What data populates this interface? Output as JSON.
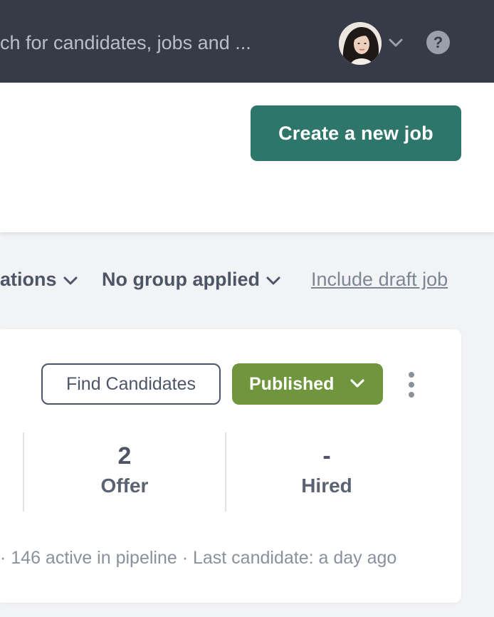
{
  "topbar": {
    "search_placeholder": "ch for candidates, jobs and ...",
    "icons": {
      "avatar": "user-avatar",
      "menu": "chevron-down-icon",
      "help": "help-icon"
    },
    "help_glyph": "?"
  },
  "header": {
    "create_job_label": "Create a new job"
  },
  "filters": {
    "locations_label": "ations",
    "group_label": "No group applied",
    "include_draft_label": "Include draft job"
  },
  "job_card": {
    "find_candidates_label": "Find Candidates",
    "status_label": "Published",
    "stats": [
      {
        "value": "2",
        "label": "Offer"
      },
      {
        "value": "-",
        "label": "Hired"
      }
    ],
    "meta": "· 146 active in pipeline · Last candidate: a day ago"
  },
  "colors": {
    "topbar_bg": "#363b47",
    "primary_button": "#2f766a",
    "published_green": "#6f963d",
    "text_dark": "#4d5566",
    "page_bg": "#f2f3f5"
  }
}
